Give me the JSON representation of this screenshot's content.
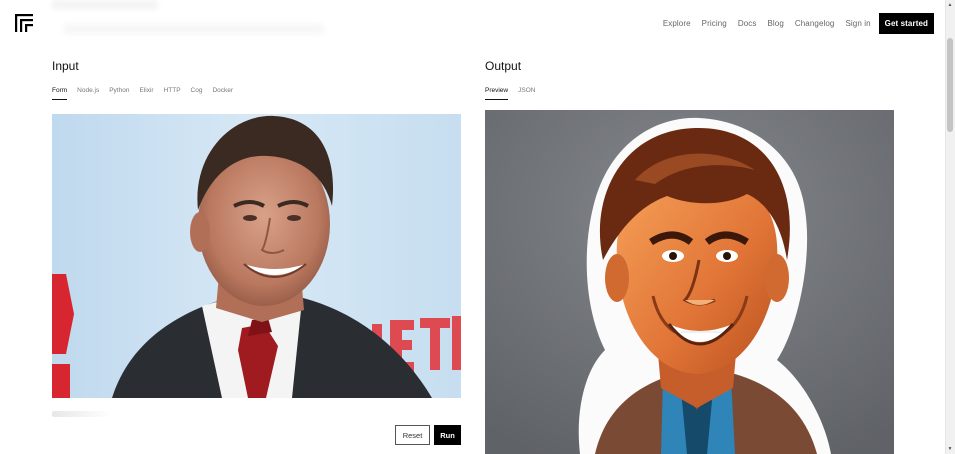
{
  "header": {
    "logo_icon": "replicate-logo-icon",
    "nav": {
      "explore": "Explore",
      "pricing": "Pricing",
      "docs": "Docs",
      "blog": "Blog",
      "changelog": "Changelog",
      "sign_in": "Sign in",
      "get_started": "Get started"
    }
  },
  "input": {
    "title": "Input",
    "tabs": [
      "Form",
      "Node.js",
      "Python",
      "Elixir",
      "HTTP",
      "Cog",
      "Docker"
    ],
    "active_tab": "Form",
    "image_alt": "photo of a smiling man in a dark suit and red tie in front of a light blue backdrop with red letters",
    "buttons": {
      "reset": "Reset",
      "run": "Run"
    }
  },
  "output": {
    "title": "Output",
    "tabs": [
      "Preview",
      "JSON"
    ],
    "active_tab": "Preview",
    "image_alt": "cartoon sticker illustration of a smiling man with slicked hair on a gray background"
  },
  "colors": {
    "accent": "#000000",
    "backdrop_blue": "#c9e0f1",
    "output_bg": "#6b6e73",
    "tie_red": "#9f1b1f"
  }
}
